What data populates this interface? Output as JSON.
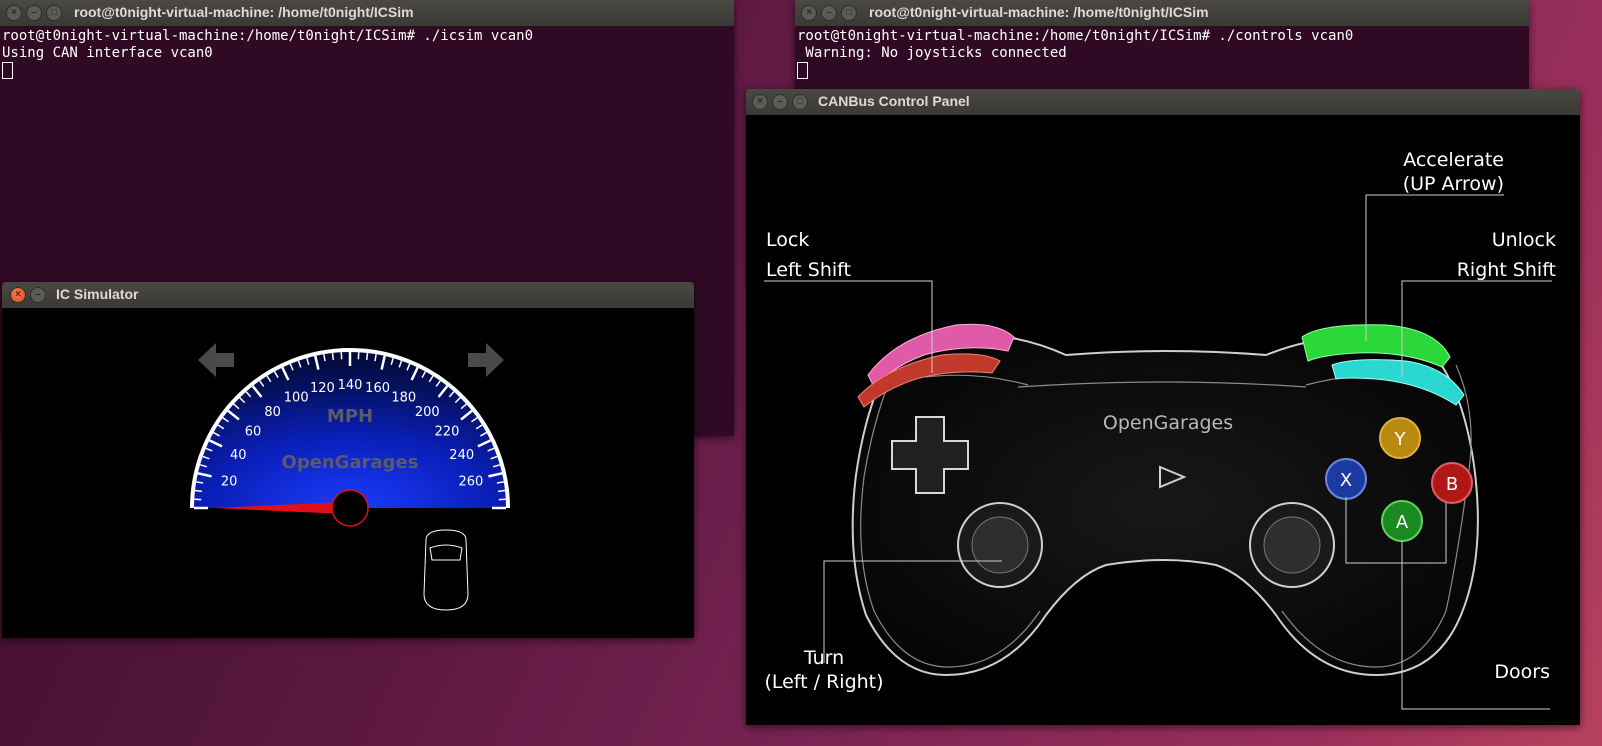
{
  "terminal_left": {
    "title": "root@t0night-virtual-machine: /home/t0night/ICSim",
    "line1": "root@t0night-virtual-machine:/home/t0night/ICSim# ./icsim vcan0",
    "line2": "Using CAN interface vcan0"
  },
  "terminal_right": {
    "title": "root@t0night-virtual-machine: /home/t0night/ICSim",
    "line1": "root@t0night-virtual-machine:/home/t0night/ICSim# ./controls vcan0",
    "line2": " Warning: No joysticks connected"
  },
  "ic_simulator": {
    "title": "IC Simulator",
    "unit_label": "MPH",
    "brand_label": "OpenGarages",
    "speed_ticks": [
      "20",
      "40",
      "60",
      "80",
      "100",
      "120",
      "140",
      "160",
      "180",
      "200",
      "220",
      "240",
      "260"
    ],
    "speed_value": 0
  },
  "control_panel": {
    "title": "CANBus Control Panel",
    "brand_label": "OpenGarages",
    "lock_label": "Lock",
    "lock_key": "Left Shift",
    "unlock_label": "Unlock",
    "unlock_key": "Right Shift",
    "accelerate_label": "Accelerate",
    "accelerate_key": "(UP Arrow)",
    "turn_label": "Turn",
    "turn_key": "(Left / Right)",
    "doors_label": "Doors",
    "button_y": "Y",
    "button_x": "X",
    "button_b": "B",
    "button_a": "A"
  },
  "colors": {
    "terminal_bg": "#300a24",
    "gauge_blue": "#0a23d8",
    "needle_red": "#e0101a",
    "lock_pink": "#e05aa8",
    "accel_green": "#2ad83a",
    "unlock_cyan": "#2ad8d0"
  }
}
